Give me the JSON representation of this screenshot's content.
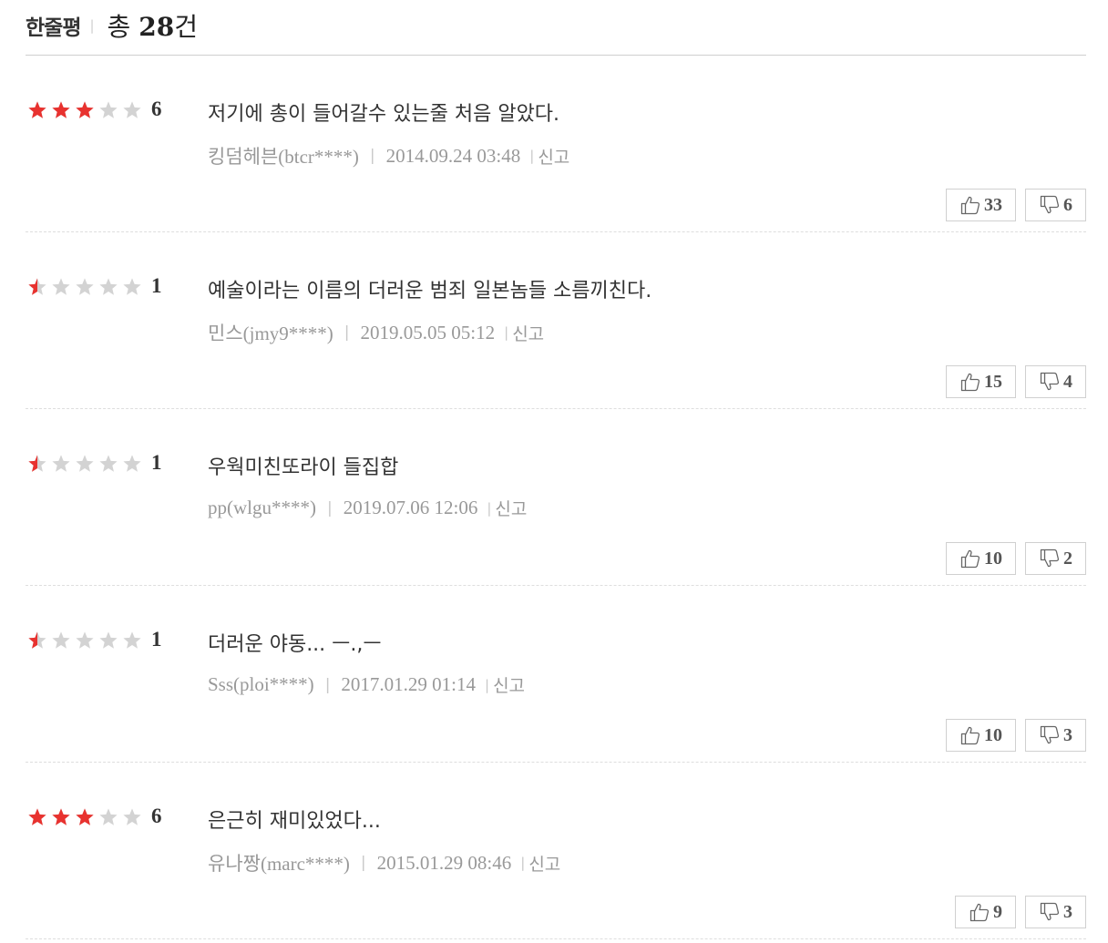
{
  "header": {
    "title": "한줄평",
    "total_prefix": "총 ",
    "total_count": "28",
    "total_suffix": "건"
  },
  "colors": {
    "star_on": "#e8322f",
    "star_off": "#d3d3d3"
  },
  "reviews": [
    {
      "rating": 3,
      "score": "6",
      "comment": "저기에 총이 들어갈수 있는줄 처음 알았다.",
      "user": "킹덤헤븐(btcr****)",
      "date": "2014.09.24 03:48",
      "report": "신고",
      "likes": "33",
      "dislikes": "6"
    },
    {
      "rating": 0.5,
      "score": "1",
      "comment": "예술이라는 이름의 더러운 범죄 일본놈들 소름끼친다.",
      "user": "민스(jmy9****)",
      "date": "2019.05.05 05:12",
      "report": "신고",
      "likes": "15",
      "dislikes": "4"
    },
    {
      "rating": 0.5,
      "score": "1",
      "comment": "우웍미친또라이 들집합",
      "user": "pp(wlgu****)",
      "date": "2019.07.06 12:06",
      "report": "신고",
      "likes": "10",
      "dislikes": "2"
    },
    {
      "rating": 0.5,
      "score": "1",
      "comment": "더러운 야동... ㅡ.,ㅡ",
      "user": "Sss(ploi****)",
      "date": "2017.01.29 01:14",
      "report": "신고",
      "likes": "10",
      "dislikes": "3"
    },
    {
      "rating": 3,
      "score": "6",
      "comment": "은근히 재미있었다...",
      "user": "유나짱(marc****)",
      "date": "2015.01.29 08:46",
      "report": "신고",
      "likes": "9",
      "dislikes": "3"
    }
  ]
}
